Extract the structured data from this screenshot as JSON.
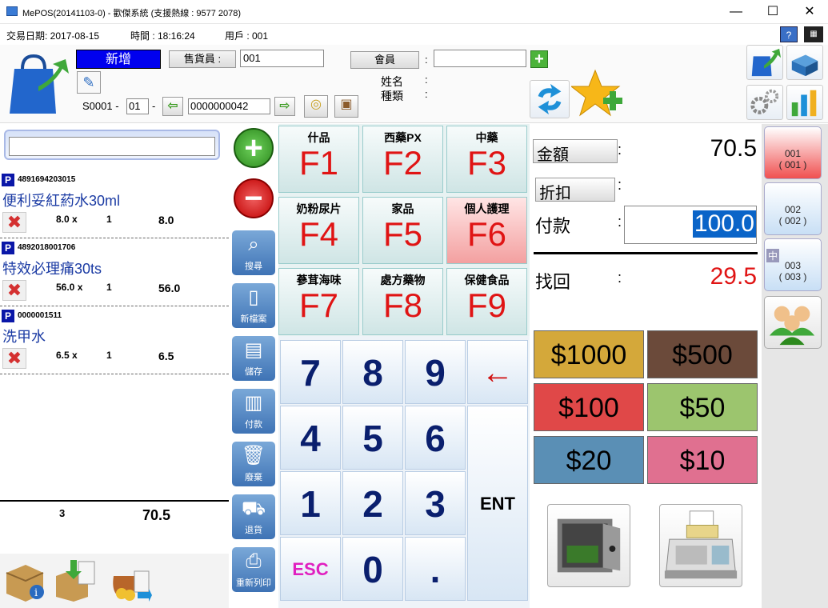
{
  "window": {
    "title": "MePOS(20141103-0) - 歡傑系統 (支援熱線 : 9577 2078)"
  },
  "info": {
    "date": "交易日期: 2017-08-15",
    "time": "時間 : 18:16:24",
    "user": "用戶 : 001"
  },
  "header": {
    "mode": "新增",
    "salesperson_label": "售貨員 :",
    "salesperson_value": "001",
    "member_label": "會員",
    "colon": ":",
    "name_label": "姓名",
    "type_label": "種類",
    "receipt_prefix": "S0001 -",
    "receipt_sub": "01",
    "dash": "-",
    "receipt_no": "0000000042"
  },
  "items": [
    {
      "code": "4891694203015",
      "name": "便利妥紅葯水30ml",
      "price": "8.0 x",
      "qty": "1",
      "amount": "8.0"
    },
    {
      "code": "4892018001706",
      "name": "特效必理痛30ts",
      "price": "56.0 x",
      "qty": "1",
      "amount": "56.0"
    },
    {
      "code": "0000001511",
      "name": "洗甲水",
      "price": "6.5 x",
      "qty": "1",
      "amount": "6.5"
    }
  ],
  "totals": {
    "count": "3",
    "amount": "70.5"
  },
  "side_buttons": [
    "搜尋",
    "新檔案",
    "儲存",
    "付款",
    "廢棄",
    "退貨",
    "重新列印"
  ],
  "categories": [
    {
      "name": "什品",
      "key": "F1"
    },
    {
      "name": "西藥PX",
      "key": "F2"
    },
    {
      "name": "中藥",
      "key": "F3"
    },
    {
      "name": "奶粉尿片",
      "key": "F4"
    },
    {
      "name": "家品",
      "key": "F5"
    },
    {
      "name": "個人護理",
      "key": "F6"
    },
    {
      "name": "蔘茸海味",
      "key": "F7"
    },
    {
      "name": "處方藥物",
      "key": "F8"
    },
    {
      "name": "保健食品",
      "key": "F9"
    }
  ],
  "numpad": {
    "k7": "7",
    "k8": "8",
    "k9": "9",
    "back": "←",
    "k4": "4",
    "k5": "5",
    "k6": "6",
    "ent": "ENT",
    "k1": "1",
    "k2": "2",
    "k3": "3",
    "esc": "ESC",
    "k0": "0",
    "dot": "."
  },
  "payment": {
    "amount_label": "金額",
    "amount": "70.5",
    "discount_label": "折扣",
    "paid_label": "付款",
    "paid": "100.0",
    "change_label": "找回",
    "change": "29.5",
    "colon": ":"
  },
  "money_buttons": [
    {
      "label": "$1000",
      "color": "#d4a83a"
    },
    {
      "label": "$500",
      "color": "#6b4a3a"
    },
    {
      "label": "$100",
      "color": "#e04848"
    },
    {
      "label": "$50",
      "color": "#9cc56e"
    },
    {
      "label": "$20",
      "color": "#5a8fb5"
    },
    {
      "label": "$10",
      "color": "#e07090"
    }
  ],
  "accounts": [
    {
      "line1": "001",
      "line2": "( 001 )"
    },
    {
      "line1": "002",
      "line2": "( 002 )"
    },
    {
      "line1": "003",
      "line2": "( 003 )"
    }
  ],
  "account_tag": "中"
}
